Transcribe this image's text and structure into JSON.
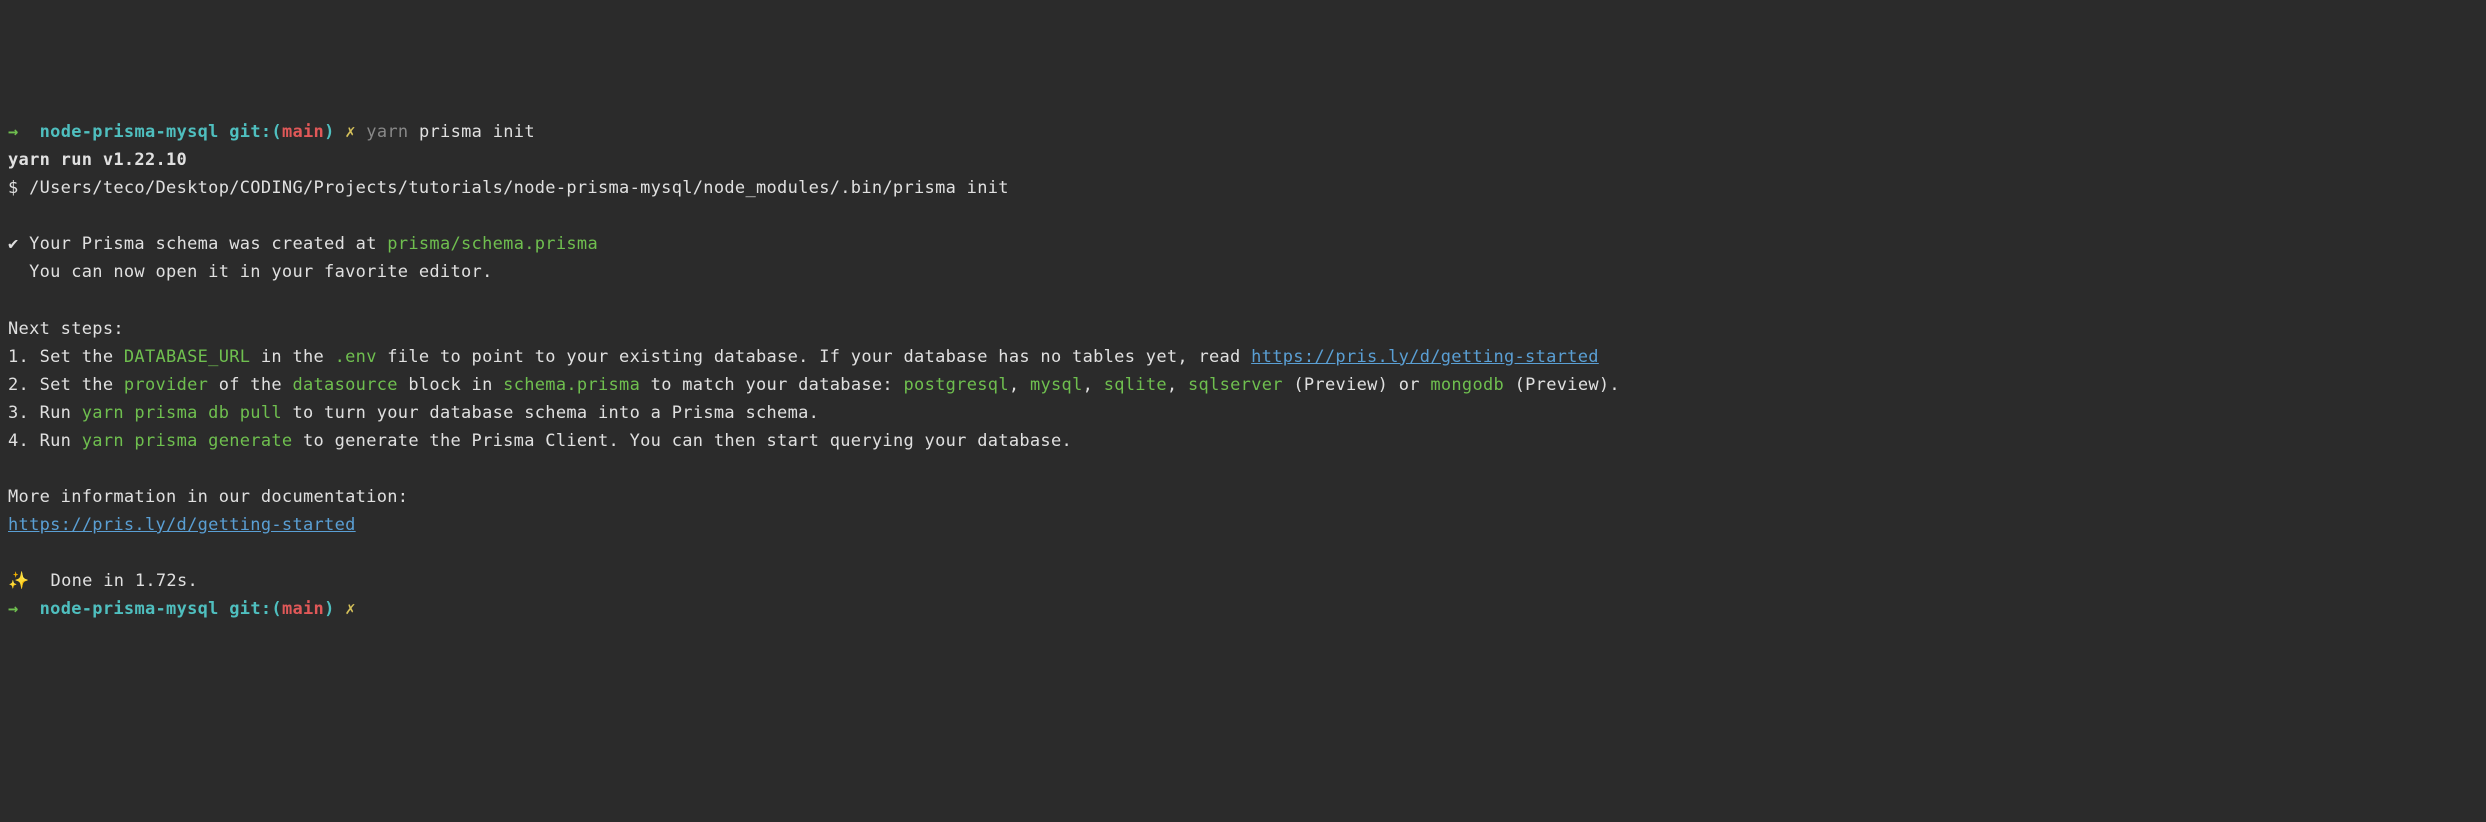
{
  "line1": {
    "arrow": "→",
    "dir": "node-prisma-mysql",
    "git_prefix": "git:(",
    "branch": "main",
    "git_suffix": ")",
    "dirty": "✗",
    "cmd": "yarn",
    "cmd_args": "prisma init"
  },
  "line2": "yarn run v1.22.10",
  "line3": {
    "prefix": "$ ",
    "text": "/Users/teco/Desktop/CODING/Projects/tutorials/node-prisma-mysql/node_modules/.bin/prisma init"
  },
  "line5": {
    "check": "✔",
    "text1": " Your Prisma schema was created at ",
    "path": "prisma/schema.prisma"
  },
  "line6": "  You can now open it in your favorite editor.",
  "line8": "Next steps:",
  "step1": {
    "prefix": "1. Set the ",
    "db_url": "DATABASE_URL",
    "mid1": " in the ",
    "env": ".env",
    "mid2": " file to point to your existing database. If your database has no tables yet, read ",
    "link": "https://pris.ly/d/getting-started"
  },
  "step2": {
    "prefix": "2. Set the ",
    "provider": "provider",
    "mid1": " of the ",
    "datasource": "datasource",
    "mid2": " block in ",
    "schema": "schema.prisma",
    "mid3": " to match your database: ",
    "pg": "postgresql",
    "c1": ", ",
    "mysql": "mysql",
    "c2": ", ",
    "sqlite": "sqlite",
    "c3": ", ",
    "sqlserver": "sqlserver",
    "preview1": " (Preview) or ",
    "mongo": "mongodb",
    "preview2": " (Preview)."
  },
  "step3": {
    "prefix": "3. Run ",
    "cmd": "yarn prisma db pull",
    "suffix": " to turn your database schema into a Prisma schema."
  },
  "step4": {
    "prefix": "4. Run ",
    "cmd": "yarn prisma generate",
    "suffix": " to generate the Prisma Client. You can then start querying your database."
  },
  "more_info": "More information in our documentation:",
  "doc_link": "https://pris.ly/d/getting-started",
  "done": {
    "sparkle": "✨",
    "text": "  Done in 1.72s."
  },
  "line_last": {
    "arrow": "→",
    "dir": "node-prisma-mysql",
    "git_prefix": "git:(",
    "branch": "main",
    "git_suffix": ")",
    "dirty": "✗"
  }
}
